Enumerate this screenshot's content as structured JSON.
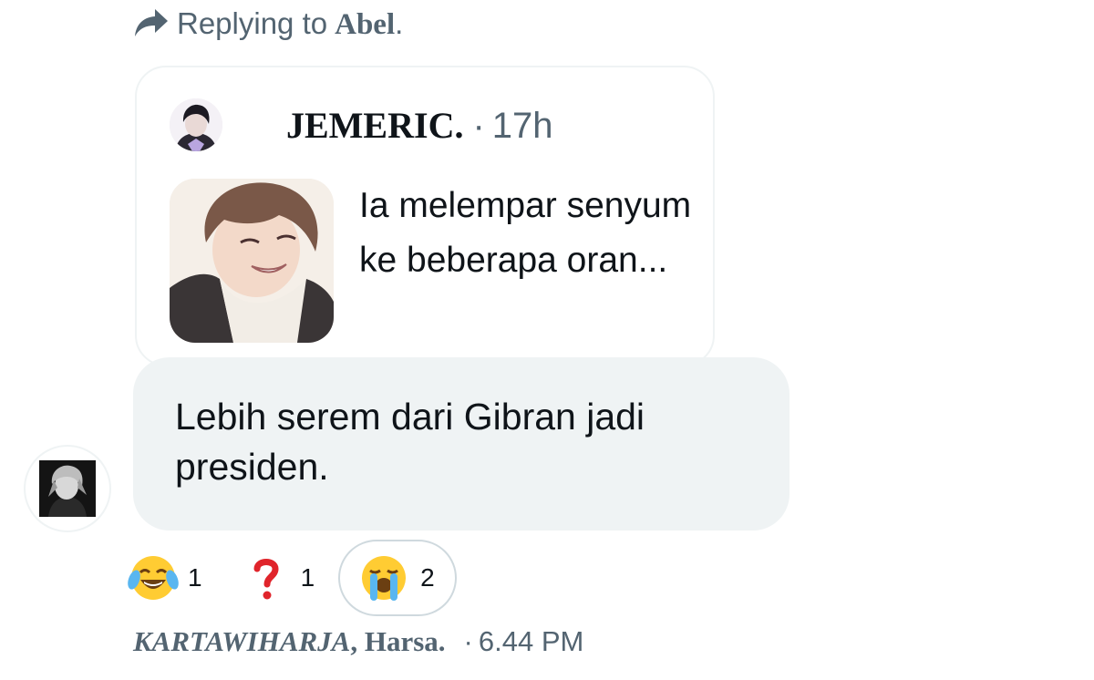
{
  "reply": {
    "prefix": "Replying to",
    "target": "Abel",
    "suffix": "."
  },
  "quoted": {
    "author": "JEMERIC.",
    "separator": "·",
    "time": "17h",
    "text": "Ia melempar senyum ke beberapa oran..."
  },
  "message": {
    "text": "Lebih serem dari Gibran jadi presiden."
  },
  "reactions": [
    {
      "emoji": "joy-face",
      "count": "1"
    },
    {
      "emoji": "red-question-mark",
      "count": "1"
    },
    {
      "emoji": "loudly-crying-face",
      "count": "2",
      "selected": true
    }
  ],
  "footer": {
    "author_part1": "KARTAWIHARJA",
    "author_part2": ", Harsa.",
    "separator": "·",
    "time": "6.44 PM"
  },
  "colors": {
    "secondary_text": "#536471",
    "bubble_bg": "#eff3f4",
    "border": "#eff3f4"
  }
}
